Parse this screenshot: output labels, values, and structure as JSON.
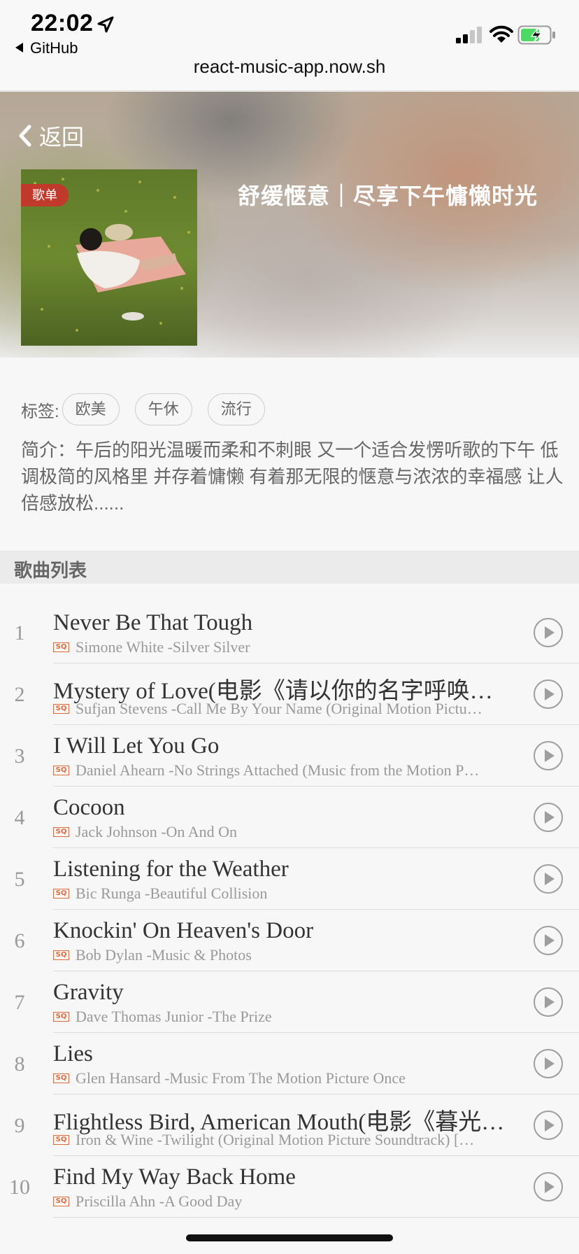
{
  "status_bar": {
    "time": "22:02",
    "back_app": "GitHub",
    "url": "react-music-app.now.sh",
    "icons": [
      "location-arrow-icon",
      "signal-icon",
      "wifi-icon",
      "battery-charging-icon"
    ]
  },
  "header": {
    "back_label": "返回",
    "cover_tag": "歌单",
    "album_title": "舒缓惬意｜尽享下午慵懒时光"
  },
  "info": {
    "tags_label": "标签:",
    "tags": [
      "欧美",
      "午休",
      "流行"
    ],
    "description": "简介：午后的阳光温暖而柔和不刺眼 又一个适合发愣听歌的下午 低调极简的风格里 并存着慵懒 有着那无限的惬意与浓浓的幸福感 让人倍感放松......"
  },
  "section_title": "歌曲列表",
  "quality_badge": "SQ",
  "songs": [
    {
      "index": "1",
      "name": "Never Be That Tough",
      "artist": "Simone White -Silver Silver"
    },
    {
      "index": "2",
      "name": "Mystery of Love(电影《请以你的名字呼唤…",
      "artist": "Sufjan Stevens -Call Me By Your Name (Original Motion Pictu…"
    },
    {
      "index": "3",
      "name": "I Will Let You Go",
      "artist": "Daniel Ahearn -No Strings Attached (Music from the Motion P…"
    },
    {
      "index": "4",
      "name": "Cocoon",
      "artist": "Jack Johnson -On And On"
    },
    {
      "index": "5",
      "name": "Listening for the Weather",
      "artist": "Bic Runga -Beautiful Collision"
    },
    {
      "index": "6",
      "name": "Knockin' On Heaven's Door",
      "artist": "Bob Dylan -Music & Photos"
    },
    {
      "index": "7",
      "name": "Gravity",
      "artist": "Dave Thomas Junior -The Prize"
    },
    {
      "index": "8",
      "name": "Lies",
      "artist": "Glen Hansard -Music From The Motion Picture Once"
    },
    {
      "index": "9",
      "name": "Flightless Bird, American Mouth(电影《暮光…",
      "artist": "Iron & Wine -Twilight (Original Motion Picture Soundtrack) […"
    },
    {
      "index": "10",
      "name": "Find My Way Back Home",
      "artist": "Priscilla Ahn -A Good Day"
    }
  ],
  "colors": {
    "accent_badge": "#c0392b",
    "quality_badge": "#e06a3c",
    "section_bg": "#ebebeb"
  }
}
